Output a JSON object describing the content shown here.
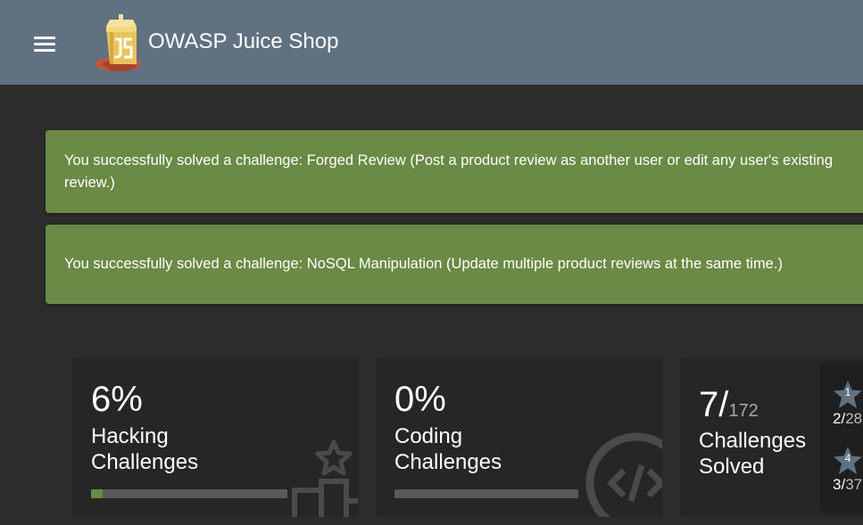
{
  "header": {
    "app_title": "OWASP Juice Shop",
    "menu_icon": "menu-icon",
    "logo_icon": "juice-box-logo-icon",
    "background_color": "#607181"
  },
  "notifications": [
    {
      "text": "You successfully solved a challenge: Forged Review (Post a product review as another user or edit any user's existing review.)"
    },
    {
      "text": "You successfully solved a challenge: NoSQL Manipulation (Update multiple product reviews at the same time.)"
    }
  ],
  "stats": {
    "hacking": {
      "percent": "6%",
      "label_line1": "Hacking",
      "label_line2": "Challenges",
      "progress": 0.06,
      "icon": "podium-star-icon"
    },
    "coding": {
      "percent": "0%",
      "label_line1": "Coding",
      "label_line2": "Challenges",
      "progress": 0.0,
      "icon": "code-icon"
    },
    "solved": {
      "count": "7",
      "separator": "/",
      "total": "172",
      "label_line1": "Challenges",
      "label_line2": "Solved"
    }
  },
  "difficulty": [
    {
      "level": "1",
      "solved": "2",
      "total": "28"
    },
    {
      "level": "4",
      "solved": "3",
      "total": "37"
    }
  ],
  "colors": {
    "accent": "#6a8a45",
    "background": "#303030",
    "card": "#262626"
  }
}
